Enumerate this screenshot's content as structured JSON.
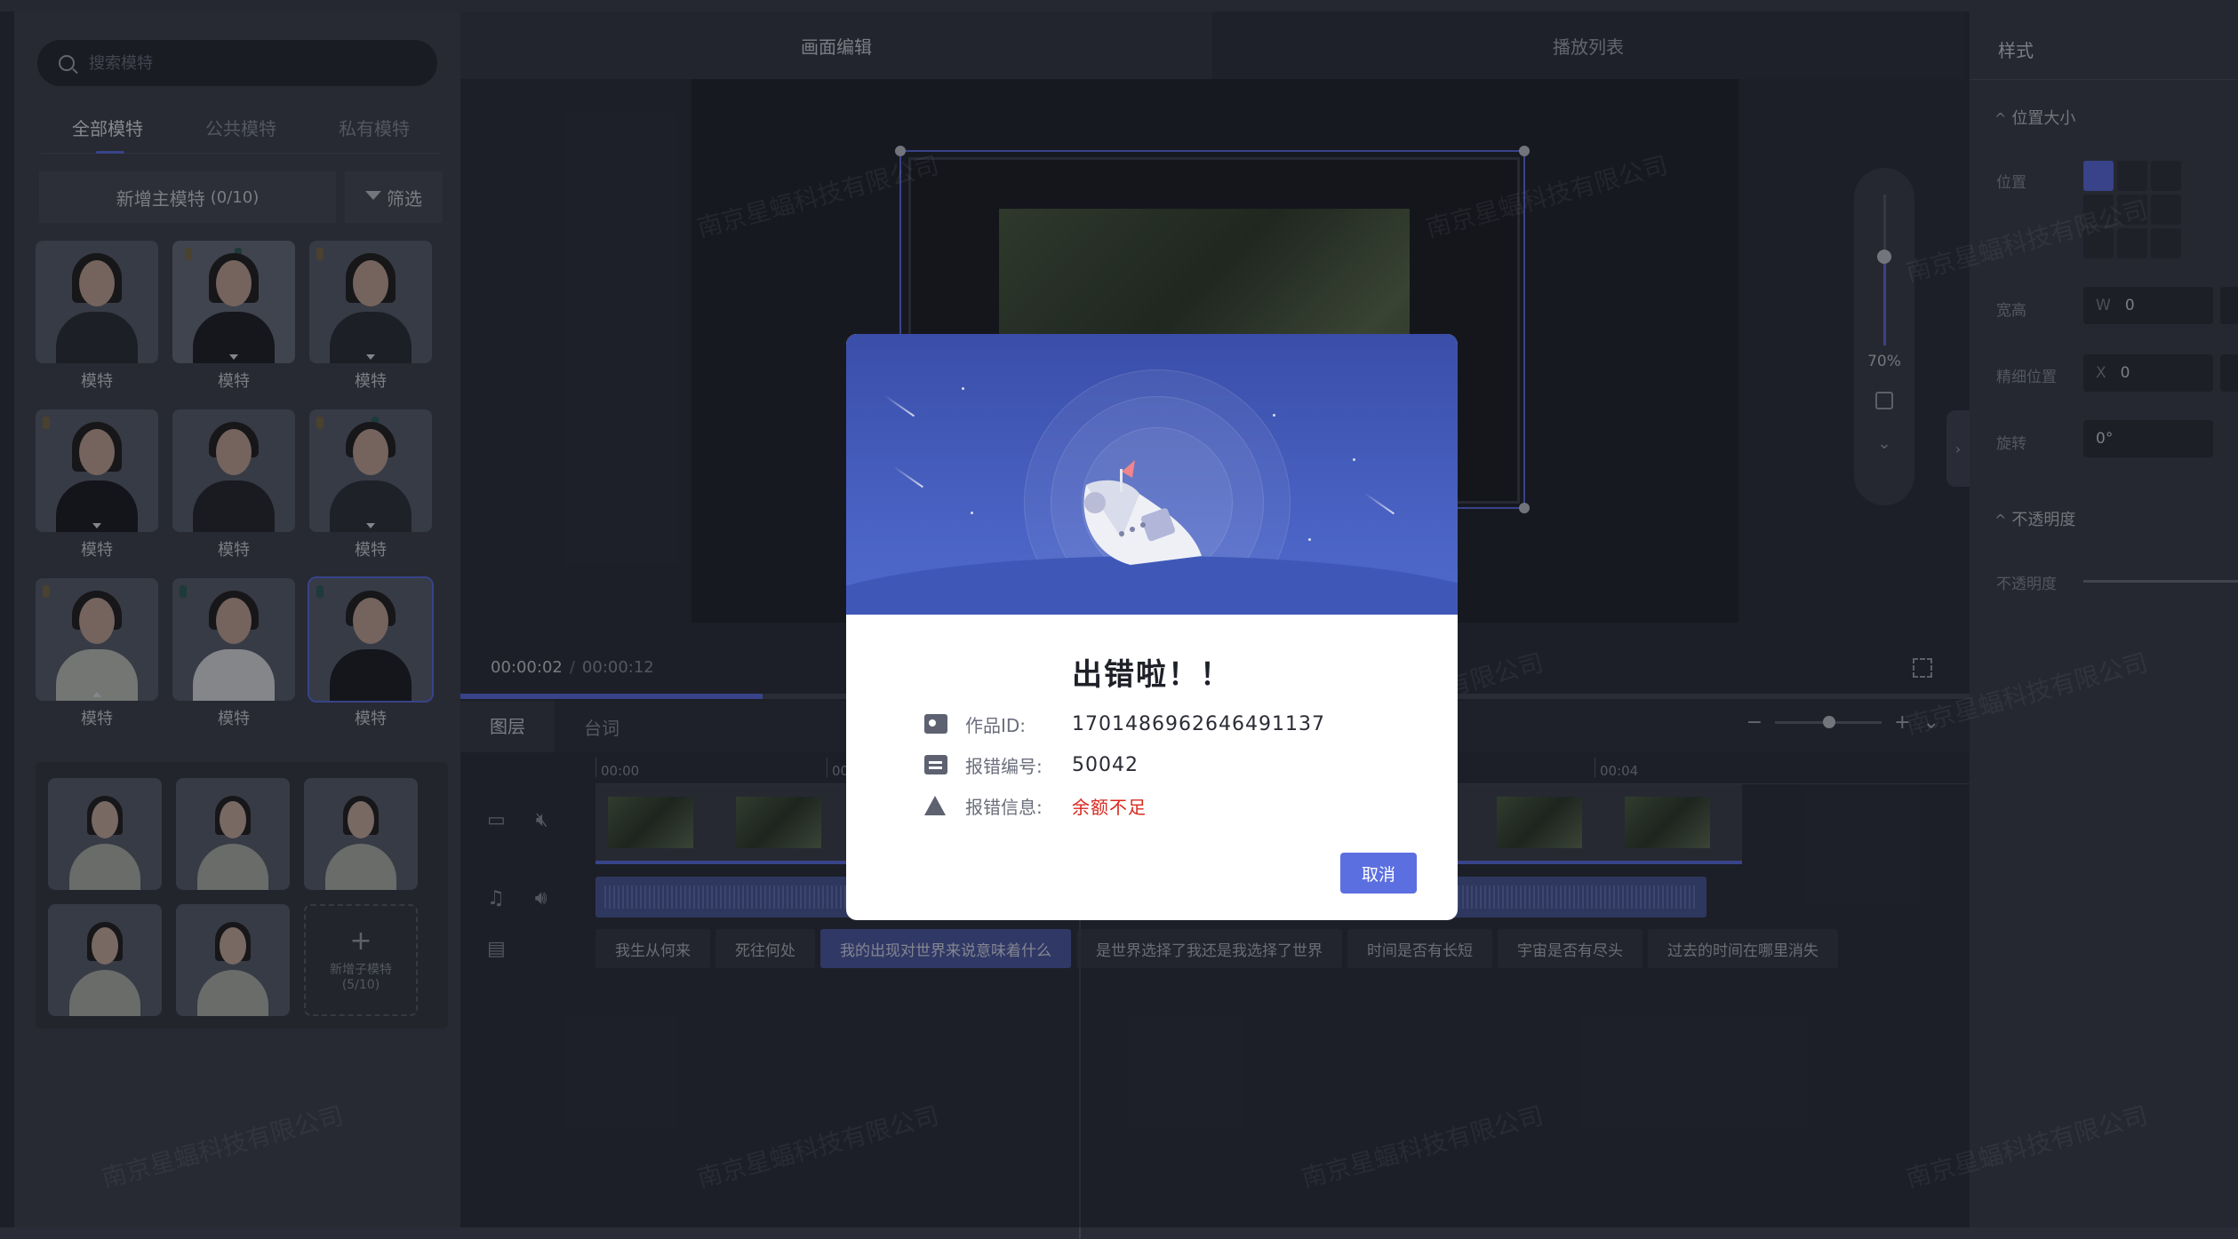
{
  "left_panel": {
    "search_placeholder": "搜索模特",
    "tabs": [
      {
        "label": "全部模特"
      },
      {
        "label": "公共模特"
      },
      {
        "label": "私有模特"
      }
    ],
    "add_main_label": "新增主模特",
    "add_main_count": "(0/10)",
    "filter_label": "筛选",
    "models": [
      {
        "label": "模特"
      },
      {
        "label": "模特"
      },
      {
        "label": "模特"
      },
      {
        "label": "模特"
      },
      {
        "label": "模特"
      },
      {
        "label": "模特"
      },
      {
        "label": "模特"
      },
      {
        "label": "模特"
      },
      {
        "label": "模特"
      }
    ],
    "add_child_label": "新增子模特",
    "add_child_count": "(5/10)"
  },
  "editor": {
    "tabs": [
      {
        "label": "画面编辑"
      },
      {
        "label": "播放列表"
      }
    ],
    "zoom_percent": "70%",
    "current_time": "00:00:02",
    "time_separator": "/",
    "total_time": "00:00:12",
    "playback_progress": 0.2,
    "timeline_tabs": [
      {
        "label": "图层"
      },
      {
        "label": "台词"
      }
    ],
    "ruler_ticks": [
      "00:00",
      "00",
      "00:04"
    ],
    "subtitles": [
      {
        "text": "我生从何来"
      },
      {
        "text": "死往何处"
      },
      {
        "text": "我的出现对世界来说意味着什么"
      },
      {
        "text": "是世界选择了我还是我选择了世界"
      },
      {
        "text": "时间是否有长短"
      },
      {
        "text": "宇宙是否有尽头"
      },
      {
        "text": "过去的时间在哪里消失"
      }
    ]
  },
  "right_panel": {
    "title": "样式",
    "section_position": "位置大小",
    "label_position": "位置",
    "label_size": "宽高",
    "size_w_key": "W",
    "size_w_value": "0",
    "label_fine_position": "精细位置",
    "pos_x_key": "X",
    "pos_x_value": "0",
    "label_rotation": "旋转",
    "rotation_value": "0°",
    "section_opacity": "不透明度",
    "label_opacity": "不透明度"
  },
  "modal": {
    "title": "出错啦！！",
    "rows": [
      {
        "key": "作品ID:",
        "value": "1701486962646491137"
      },
      {
        "key": "报错编号:",
        "value": "50042"
      },
      {
        "key": "报错信息:",
        "value": "余额不足"
      }
    ],
    "cancel_label": "取消",
    "error_color": "#d9281f",
    "accent_color": "#5c6fe0"
  },
  "watermark_text": "南京星蝠科技有限公司"
}
